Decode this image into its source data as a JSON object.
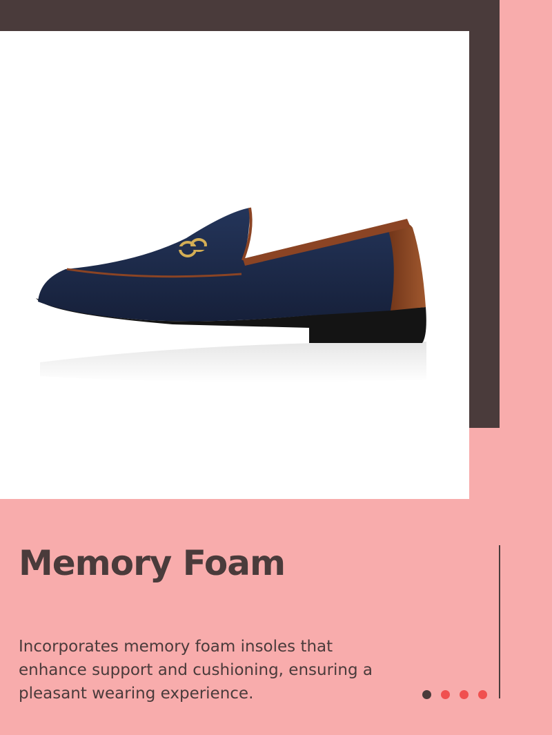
{
  "slide": {
    "title": "Memory Foam",
    "description": "Incorporates memory foam insoles that enhance support and cushioning, ensuring a pleasant wearing experience.",
    "image_subject": "navy-suede-horsebit-loafer",
    "pagination": {
      "total": 4,
      "current": 1
    }
  },
  "colors": {
    "background": "#F8ACAC",
    "frame": "#4A3B3B",
    "text": "#4A3B3B",
    "accent_dot": "#F0504F",
    "shoe_upper": "#1B2742",
    "shoe_leather": "#8B4424",
    "buckle": "#D4AE55"
  }
}
